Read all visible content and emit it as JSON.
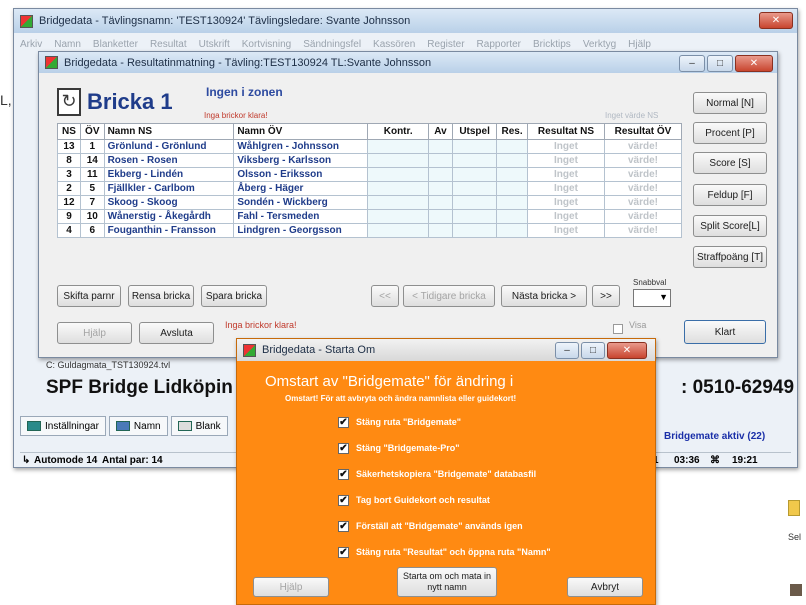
{
  "main": {
    "title": "Bridgedata - Tävlingsnamn: 'TEST130924' Tävlingsledare: Svante Johnsson",
    "menu": [
      "Arkiv",
      "Namn",
      "Blanketter",
      "Resultat",
      "Utskrift",
      "Kortvisning",
      "Sändningsfel",
      "Kassören",
      "Register",
      "Rapporter",
      "Bricktips",
      "Verktyg",
      "Hjälp"
    ],
    "club_sub": "C: Guldagmata_TST130924.tvl",
    "club": "SPF Bridge Lidköpin",
    "phone": ": 0510-62949",
    "tabs": [
      "Inställningar",
      "Namn",
      "Blank"
    ],
    "bridgemate_status": "Bridgemate aktiv (22)",
    "status": {
      "mode": "Automode 14",
      "pairs": "Antal par: 14",
      "round": "1",
      "time1": "03:36",
      "time2": "19:21"
    }
  },
  "results": {
    "title": "Bridgedata - Resultatinmatning - Tävling:TEST130924 TL:Svante Johnsson",
    "bricka": "Bricka 1",
    "zone": "Ingen i zonen",
    "no_clear": "Inga brickor klara!",
    "no_value": "Inget värde NS",
    "columns": [
      "NS",
      "ÖV",
      "Namn NS",
      "Namn ÖV",
      "Kontr.",
      "Av",
      "Utspel",
      "Res.",
      "Resultat NS",
      "Resultat ÖV"
    ],
    "rows": [
      {
        "ns": "13",
        "ov": "1",
        "name_ns": "Grönlund - Grönlund",
        "name_ov": "Wåhlgren - Johnsson",
        "res_ns": "Inget",
        "res_ov": "värde!"
      },
      {
        "ns": "8",
        "ov": "14",
        "name_ns": "Rosen - Rosen",
        "name_ov": "Viksberg - Karlsson",
        "res_ns": "Inget",
        "res_ov": "värde!"
      },
      {
        "ns": "3",
        "ov": "11",
        "name_ns": "Ekberg - Lindén",
        "name_ov": "Olsson - Eriksson",
        "res_ns": "Inget",
        "res_ov": "värde!"
      },
      {
        "ns": "2",
        "ov": "5",
        "name_ns": "Fjällkler - Carlbom",
        "name_ov": "Åberg - Häger",
        "res_ns": "Inget",
        "res_ov": "värde!"
      },
      {
        "ns": "12",
        "ov": "7",
        "name_ns": "Skoog - Skoog",
        "name_ov": "Sondén - Wickberg",
        "res_ns": "Inget",
        "res_ov": "värde!"
      },
      {
        "ns": "9",
        "ov": "10",
        "name_ns": "Wånerstig - Åkegårdh",
        "name_ov": "Fahl - Tersmeden",
        "res_ns": "Inget",
        "res_ov": "värde!"
      },
      {
        "ns": "4",
        "ov": "6",
        "name_ns": "Fouganthin - Fransson",
        "name_ov": "Lindgren - Georgsson",
        "res_ns": "Inget",
        "res_ov": "värde!"
      }
    ],
    "side_buttons": [
      "Normal [N]",
      "Procent [P]",
      "Score [S]",
      "Feldup [F]",
      "Split Score[L]",
      "Straffpoäng [T]"
    ],
    "btn_swap": "Skifta parnr",
    "btn_clear": "Rensa bricka",
    "btn_save": "Spara bricka",
    "btn_first": "<<",
    "btn_prev": "< Tidigare bricka",
    "btn_next": "Nästa bricka >",
    "btn_last": ">>",
    "quick_label": "Snabbval",
    "btn_help": "Hjälp",
    "btn_exit": "Avsluta",
    "no_clear_bottom": "Inga brickor klara!",
    "show_label": "Visa",
    "btn_done": "Klart"
  },
  "dialog": {
    "title": "Bridgedata - Starta Om",
    "heading": "Omstart av \"Bridgemate\" för ändring i",
    "subheading": "Omstart! För att avbryta och ändra namnlista eller guidekort!",
    "options": [
      "Stäng ruta \"Bridgemate\"",
      "Stäng \"Bridgemate-Pro\"",
      "Säkerhetskopiera \"Bridgemate\" databasfil",
      "Tag bort Guidekort och resultat",
      "Förställ att \"Bridgemate\" används igen",
      "Stäng ruta \"Resultat\" och öppna ruta \"Namn\""
    ],
    "btn_help": "Hjälp",
    "btn_restart": "Starta om och mata in nytt namn",
    "btn_cancel": "Avbryt"
  },
  "desktop": {
    "sel": "Sel",
    "edge": "L,"
  }
}
